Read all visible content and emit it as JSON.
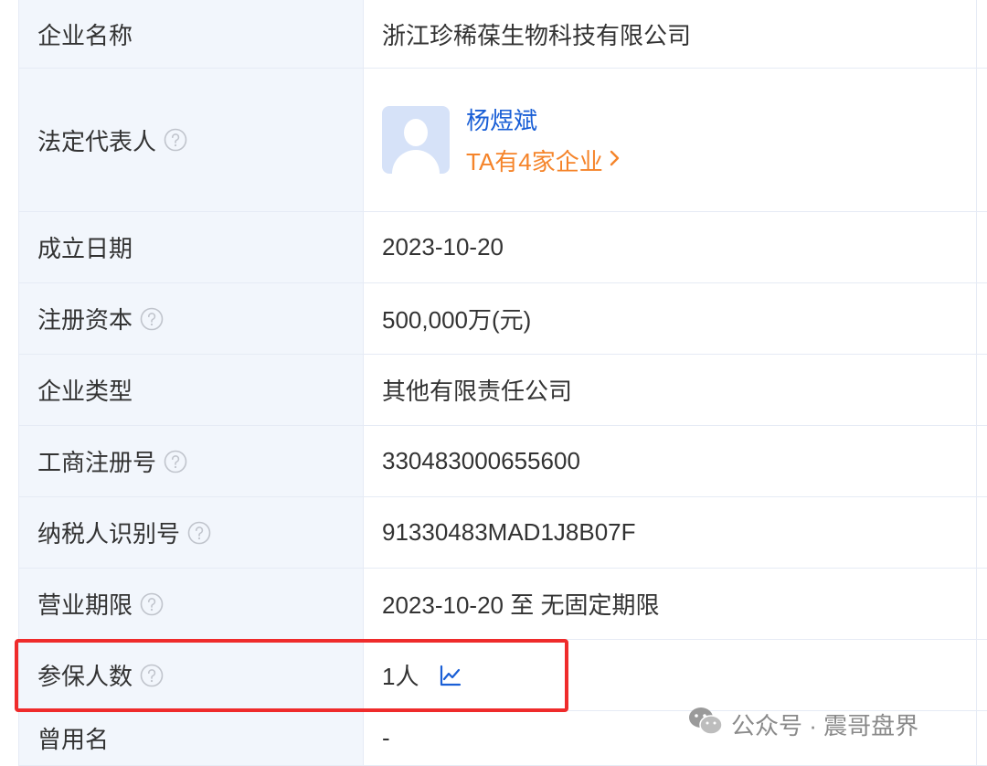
{
  "rows": [
    {
      "label": "企业名称",
      "value": "浙江珍稀葆生物科技有限公司",
      "help": false
    },
    {
      "label": "法定代表人",
      "help": true,
      "person": {
        "name": "杨煜斌",
        "link": "TA有4家企业"
      }
    },
    {
      "label": "成立日期",
      "value": "2023-10-20",
      "help": false
    },
    {
      "label": "注册资本",
      "value": "500,000万(元)",
      "help": true
    },
    {
      "label": "企业类型",
      "value": "其他有限责任公司",
      "help": false
    },
    {
      "label": "工商注册号",
      "value": "330483000655600",
      "help": true
    },
    {
      "label": "纳税人识别号",
      "value": "91330483MAD1J8B07F",
      "help": true
    },
    {
      "label": "营业期限",
      "value": "2023-10-20 至 无固定期限",
      "help": true
    },
    {
      "label": "参保人数",
      "value": "1人",
      "help": true
    },
    {
      "label": "曾用名",
      "value": "-",
      "help": false
    }
  ],
  "icons": {
    "help": "question-circle-icon",
    "trend": "line-chart-icon",
    "arrow": "chevron-right-icon",
    "wechat": "wechat-icon"
  },
  "colors": {
    "label_bg": "#f2f6fc",
    "link_blue": "#1a5fd6",
    "link_orange": "#f5842a",
    "highlight_red": "#ef2b2b"
  },
  "watermark": {
    "text": "公众号 · 震哥盘界"
  }
}
